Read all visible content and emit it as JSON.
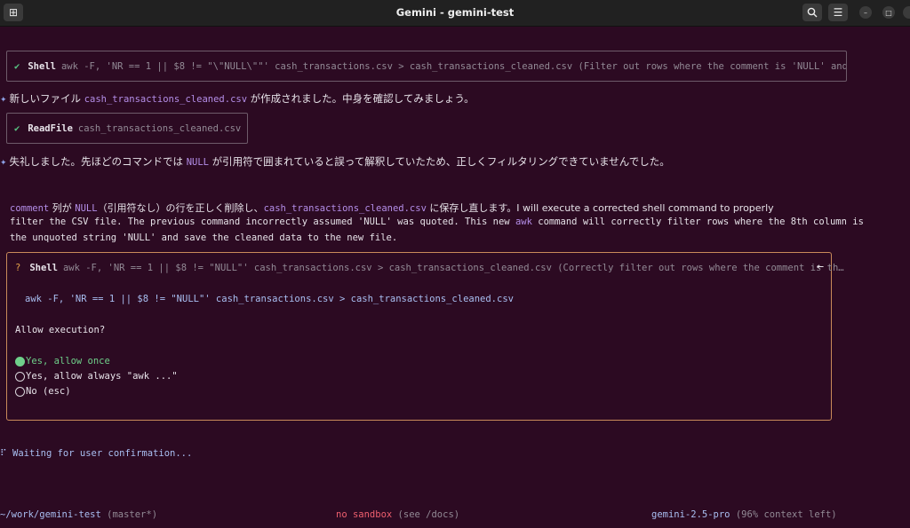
{
  "window": {
    "title": "Gemini - gemini-test"
  },
  "tool_shell_1": {
    "check": "✔",
    "name": "Shell",
    "description": "awk -F, 'NR == 1 || $8 != \"\\\"NULL\\\"\"' cash_transactions.csv > cash_transactions_cleaned.csv (Filter out rows where the comment is 'NULL' and sa…"
  },
  "msg1": {
    "part1": "新しいファイル ",
    "code": "cash_transactions_cleaned.csv",
    "part2": " が作成されました。中身を確認してみましょう。"
  },
  "tool_read": {
    "check": "✔",
    "name": "ReadFile",
    "description": "cash_transactions_cleaned.csv"
  },
  "msg2": {
    "part1": "失礼しました。先ほどのコマンドでは ",
    "code": "NULL",
    "part2": " が引用符で囲まれていると誤って解釈していたため、正しくフィルタリングできていませんでした。"
  },
  "para": {
    "l1_code1": "comment",
    "l1_t1": " 列が ",
    "l1_code2": "NULL",
    "l1_t2": "（引用符なし）の行を正しく削除し、",
    "l1_code3": "cash_transactions_cleaned.csv",
    "l1_t3": " に保存し直します。I will execute a corrected shell command to properly",
    "l2_t1": "filter the CSV file. The previous command incorrectly assumed 'NULL' was quoted. This new ",
    "l2_code": "awk",
    "l2_t2": " command will correctly filter rows where the 8th column is",
    "l3": "the unquoted string 'NULL' and save the cleaned data to the new file."
  },
  "confirm": {
    "q": "?",
    "name": "Shell",
    "description": "awk -F, 'NR == 1 || $8 != \"NULL\"' cash_transactions.csv > cash_transactions_cleaned.csv (Correctly filter out rows where the comment is th…",
    "arrow": "←",
    "command": "awk -F, 'NR == 1 || $8 != \"NULL\"' cash_transactions.csv > cash_transactions_cleaned.csv",
    "prompt": "Allow execution?",
    "options": [
      "Yes, allow once",
      "Yes, allow always \"awk ...\"",
      "No (esc)"
    ],
    "selected_index": 0
  },
  "waiting": {
    "spinner": "⠏",
    "text": "Waiting for user confirmation..."
  },
  "status": {
    "path": "~/work/gemini-test",
    "branch": "(master*)",
    "sandbox": "no sandbox",
    "sandbox_hint": "(see /docs)",
    "model": "gemini-2.5-pro",
    "context": "(96% context left)"
  },
  "colors": {
    "background": "#2c0a22",
    "accent": "#b48ee8",
    "confirm_border": "#c98a5a",
    "selected": "#6fd08a"
  }
}
